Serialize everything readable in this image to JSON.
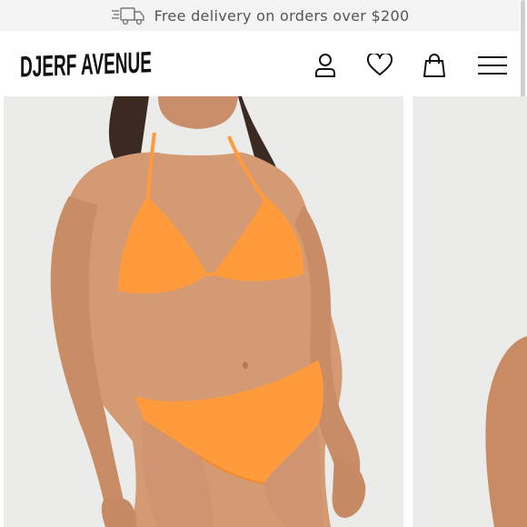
{
  "banner": {
    "text": "Free delivery on orders over $200",
    "icon": "delivery-truck-icon"
  },
  "header": {
    "brand": "DJERF AVENUE",
    "icons": [
      "account-icon",
      "heart-icon",
      "shopping-bag-icon",
      "menu-icon"
    ]
  },
  "gallery": {
    "images": [
      "product-photo-orange-bikini",
      "product-photo-next"
    ]
  },
  "colors": {
    "banner_bg": "#f3f3f3",
    "banner_text": "#555555",
    "photo_bg": "#ebebea",
    "bikini": "#ff9a3d",
    "skin": "#d49a73"
  }
}
